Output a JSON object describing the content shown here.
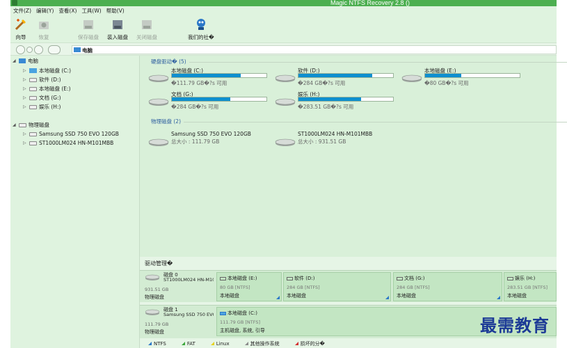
{
  "window": {
    "title": "Magic NTFS Recovery 2.8 ()"
  },
  "menu": [
    "文件(Z)",
    "编辑(Y)",
    "查看(X)",
    "工具(W)",
    "帮助(V)"
  ],
  "toolbar": {
    "wizard": "向导",
    "restore": "恢复",
    "save_disk": "保存磁盘",
    "load_disk": "装入磁盘",
    "close_disk": "关闭磁盘",
    "community": "我们的社�"
  },
  "address": {
    "path": "电脑"
  },
  "tree": {
    "root": "电脑",
    "drives": [
      "本地磁盘 (C:)",
      "软件 (D:)",
      "本地磁盘 (E:)",
      "文档 (G:)",
      "娱乐 (H:)"
    ],
    "physical_root": "物理磁盘",
    "physical": [
      "Samsung SSD 750 EVO 120GB",
      "ST1000LM024 HN-M101MBB"
    ]
  },
  "hard_drives": {
    "header": "硬盘驱动� (5)",
    "items": [
      {
        "name": "本地磁盘 (C:)",
        "free": "�111.79 GB�?s 可用",
        "used_fraction": 0.73,
        "icon": "windows-drive-icon"
      },
      {
        "name": "软件 (D:)",
        "free": "�284 GB�?s 可用",
        "used_fraction": 0.78
      },
      {
        "name": "本地磁盘 (E:)",
        "free": "�80 GB�?s 可用",
        "used_fraction": 0.38
      },
      {
        "name": "文档 (G:)",
        "free": "�284 GB�?s 可用",
        "used_fraction": 0.62
      },
      {
        "name": "娱乐 (H:)",
        "free": "�283.51 GB�?s 可用",
        "used_fraction": 0.66
      }
    ]
  },
  "physical_disks": {
    "header": "物理磁盘 (2)",
    "items": [
      {
        "name": "Samsung SSD 750 EVO 120GB",
        "size": "总大小 : 111.79 GB"
      },
      {
        "name": "ST1000LM024 HN-M101MBB",
        "size": "总大小 : 931.51 GB"
      }
    ]
  },
  "drive_management": {
    "title": "驱动管理�",
    "disks": [
      {
        "name": "磁盘 0",
        "model": "ST1000LM024 HN-M10",
        "size": "931.51 GB",
        "type": "物理磁盘",
        "partitions": [
          {
            "name": "本地磁盘 (E:)",
            "info": "80 GB [NTFS]",
            "type": "本地磁盘"
          },
          {
            "name": "软件 (D:)",
            "info": "284 GB [NTFS]",
            "type": "本地磁盘"
          },
          {
            "name": "文档 (G:)",
            "info": "284 GB [NTFS]",
            "type": "本地磁盘"
          },
          {
            "name": "娱乐 (H:)",
            "info": "283.51 GB [NTFS]",
            "type": "本地磁盘"
          }
        ]
      },
      {
        "name": "磁盘 1",
        "model": "Samsung SSD 750 EVO",
        "size": "111.79 GB",
        "type": "物理磁盘",
        "partitions": [
          {
            "name": "本地磁盘 (C:)",
            "info": "111.79 GB [NTFS]",
            "type": "主机磁盘, 系统, 引导"
          }
        ]
      }
    ],
    "legend": [
      "NTFS",
      "FAT",
      "Linux",
      "其他操作系统",
      "损坏的分�"
    ]
  },
  "watermark": "最需教育",
  "colors": {
    "title_bar": "#4caf50",
    "bar_fill": "#0e8fcf",
    "panel": "#dff3df"
  }
}
